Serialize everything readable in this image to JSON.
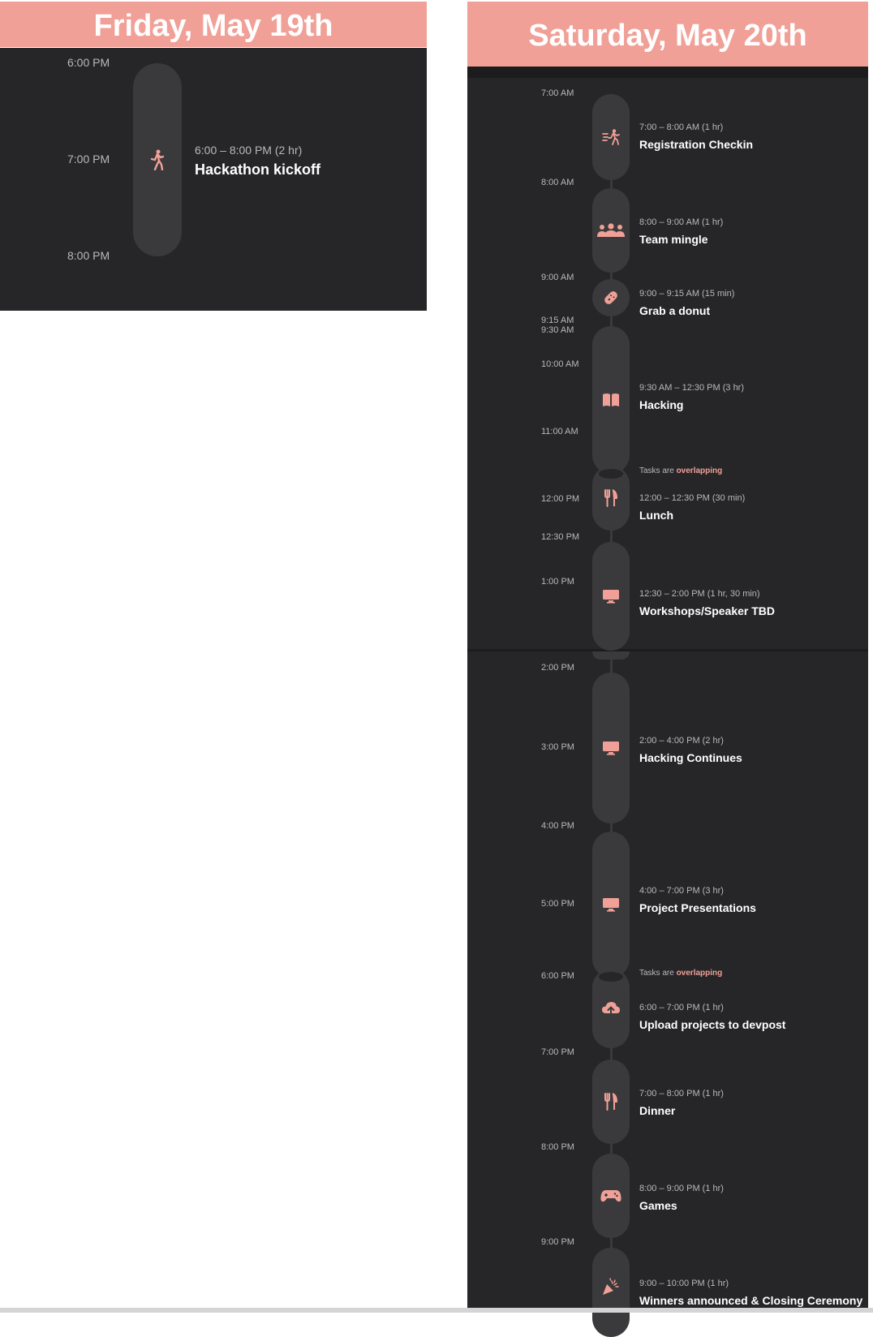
{
  "friday": {
    "header": "Friday, May 19th",
    "times": [
      "6:00 PM",
      "7:00 PM",
      "8:00 PM"
    ],
    "event": {
      "range": "6:00 – 8:00 PM (2 hr)",
      "title": "Hackathon kickoff",
      "icon": "walking-person-icon"
    }
  },
  "saturday": {
    "header": "Saturday, May 20th",
    "times": [
      "7:00 AM",
      "8:00 AM",
      "9:00 AM",
      "9:15 AM",
      "9:30 AM",
      "10:00 AM",
      "11:00 AM",
      "12:00 PM",
      "12:30 PM",
      "1:00 PM",
      "2:00 PM",
      "3:00 PM",
      "4:00 PM",
      "5:00 PM",
      "6:00 PM",
      "7:00 PM",
      "8:00 PM",
      "9:00 PM"
    ],
    "overlap_warning": {
      "prefix": "Tasks are",
      "highlight": "overlapping"
    },
    "events": [
      {
        "range": "7:00 – 8:00 AM (1 hr)",
        "title": "Registration Checkin",
        "icon": "running-person-icon"
      },
      {
        "range": "8:00 – 9:00 AM (1 hr)",
        "title": "Team mingle",
        "icon": "group-icon"
      },
      {
        "range": "9:00 – 9:15 AM (15 min)",
        "title": "Grab a donut",
        "icon": "donut-icon"
      },
      {
        "range": "9:30 AM – 12:30 PM (3 hr)",
        "title": "Hacking",
        "icon": "book-icon"
      },
      {
        "range": "12:00 – 12:30 PM (30 min)",
        "title": "Lunch",
        "icon": "fork-knife-icon"
      },
      {
        "range": "12:30 – 2:00 PM (1 hr, 30 min)",
        "title": "Workshops/Speaker TBD",
        "icon": "monitor-icon"
      },
      {
        "range": "2:00 – 4:00 PM (2 hr)",
        "title": "Hacking Continues",
        "icon": "monitor-icon"
      },
      {
        "range": "4:00 – 7:00 PM (3 hr)",
        "title": "Project Presentations",
        "icon": "monitor-icon"
      },
      {
        "range": "6:00 – 7:00 PM (1 hr)",
        "title": "Upload projects to devpost",
        "icon": "cloud-upload-icon"
      },
      {
        "range": "7:00 – 8:00 PM (1 hr)",
        "title": "Dinner",
        "icon": "fork-knife-icon"
      },
      {
        "range": "8:00 – 9:00 PM (1 hr)",
        "title": "Games",
        "icon": "gamepad-icon"
      },
      {
        "range": "9:00 – 10:00 PM (1 hr)",
        "title": "Winners announced & Closing Ceremony",
        "icon": "party-popper-icon"
      }
    ]
  },
  "colors": {
    "accent": "#f0a097",
    "panel": "#262628",
    "pill": "#3a3a3c",
    "text": "#ffffff",
    "muted": "#b9b9bb"
  }
}
